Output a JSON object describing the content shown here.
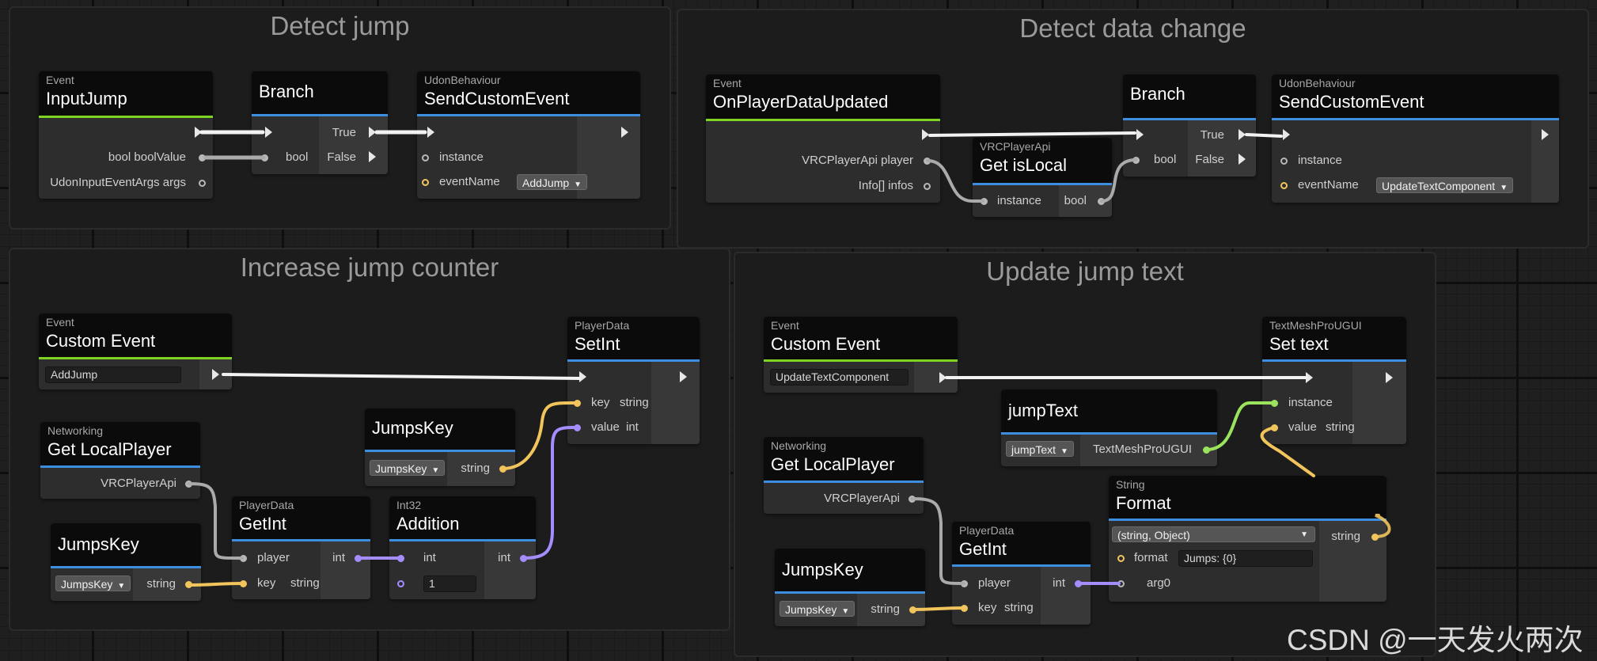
{
  "groups": {
    "detect_jump": "Detect jump",
    "detect_data_change": "Detect data change",
    "increase_jump_counter": "Increase jump counter",
    "update_jump_text": "Update jump text"
  },
  "colors": {
    "event_underline": "#7ed321",
    "node_underline": "#3d8de0",
    "flow_wire": "#f2f2f2",
    "bool_wire": "#aaaaaa",
    "string_wire": "#f2c55c",
    "int_wire": "#a58cff",
    "textmesh_wire": "#9ce35d"
  },
  "detect_jump": {
    "input_jump": {
      "category": "Event",
      "title": "InputJump",
      "out_bool": "bool boolValue",
      "out_args": "UdonInputEventArgs args"
    },
    "branch": {
      "title": "Branch",
      "in_bool": "bool",
      "out_true": "True",
      "out_false": "False"
    },
    "send_custom_event": {
      "category": "UdonBehaviour",
      "title": "SendCustomEvent",
      "in_instance": "instance",
      "in_event_name": "eventName",
      "event_name_value": "AddJump"
    }
  },
  "detect_data_change": {
    "on_player_data_updated": {
      "category": "Event",
      "title": "OnPlayerDataUpdated",
      "out_player": "VRCPlayerApi player",
      "out_infos": "Info[] infos"
    },
    "get_is_local": {
      "category": "VRCPlayerApi",
      "title": "Get isLocal",
      "in_instance": "instance",
      "out_bool": "bool"
    },
    "branch": {
      "title": "Branch",
      "in_bool": "bool",
      "out_true": "True",
      "out_false": "False"
    },
    "send_custom_event": {
      "category": "UdonBehaviour",
      "title": "SendCustomEvent",
      "in_instance": "instance",
      "in_event_name": "eventName",
      "event_name_value": "UpdateTextComponent"
    }
  },
  "increase_jump_counter": {
    "custom_event": {
      "category": "Event",
      "title": "Custom Event",
      "value": "AddJump"
    },
    "get_local_player": {
      "category": "Networking",
      "title": "Get LocalPlayer",
      "out": "VRCPlayerApi"
    },
    "jumps_key_a": {
      "title": "JumpsKey",
      "dropdown": "JumpsKey",
      "out": "string"
    },
    "jumps_key_b": {
      "title": "JumpsKey",
      "dropdown": "JumpsKey",
      "out": "string"
    },
    "get_int": {
      "category": "PlayerData",
      "title": "GetInt",
      "in_player": "player",
      "in_key": "key",
      "in_key_type": "string",
      "out": "int"
    },
    "addition": {
      "category": "Int32",
      "title": "Addition",
      "in_a": "int",
      "in_b_value": "1",
      "out": "int"
    },
    "set_int": {
      "category": "PlayerData",
      "title": "SetInt",
      "in_key": "key",
      "in_key_type": "string",
      "in_value": "value",
      "in_value_type": "int"
    }
  },
  "update_jump_text": {
    "custom_event": {
      "category": "Event",
      "title": "Custom Event",
      "value": "UpdateTextComponent"
    },
    "jump_text": {
      "title": "jumpText",
      "dropdown": "jumpText",
      "out": "TextMeshProUGUI"
    },
    "set_text": {
      "category": "TextMeshProUGUI",
      "title": "Set text",
      "in_instance": "instance",
      "in_value": "value",
      "in_value_type": "string"
    },
    "get_local_player": {
      "category": "Networking",
      "title": "Get LocalPlayer",
      "out": "VRCPlayerApi"
    },
    "format": {
      "category": "String",
      "title": "Format",
      "overload": "(string, Object)",
      "in_format": "format",
      "format_value": "Jumps: {0}",
      "in_arg0": "arg0",
      "out": "string"
    },
    "get_int": {
      "category": "PlayerData",
      "title": "GetInt",
      "in_player": "player",
      "in_key": "key",
      "in_key_type": "string",
      "out": "int"
    },
    "jumps_key": {
      "title": "JumpsKey",
      "dropdown": "JumpsKey",
      "out": "string"
    }
  },
  "watermark": "CSDN @一天发火两次"
}
